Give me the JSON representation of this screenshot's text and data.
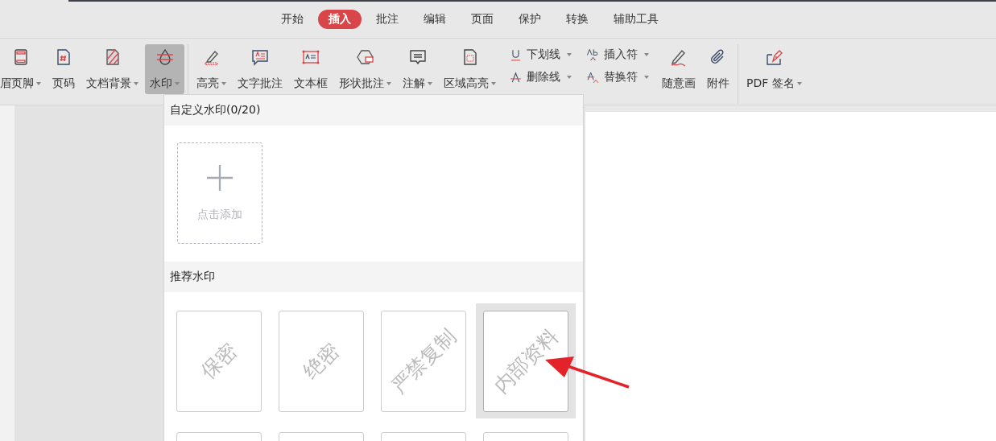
{
  "menu_tabs": [
    {
      "label": "开始",
      "selected": false
    },
    {
      "label": "插入",
      "selected": true
    },
    {
      "label": "批注",
      "selected": false
    },
    {
      "label": "编辑",
      "selected": false
    },
    {
      "label": "页面",
      "selected": false
    },
    {
      "label": "保护",
      "selected": false
    },
    {
      "label": "转换",
      "selected": false
    },
    {
      "label": "辅助工具",
      "selected": false
    }
  ],
  "toolbar": {
    "groups": [
      {
        "items": [
          {
            "kind": "big",
            "label": "眉页脚",
            "has_menu": true,
            "selected": false
          },
          {
            "kind": "big",
            "label": "页码",
            "has_menu": false,
            "selected": false
          },
          {
            "kind": "big",
            "label": "文档背景",
            "has_menu": true,
            "selected": false
          },
          {
            "kind": "big",
            "label": "水印",
            "has_menu": true,
            "selected": true
          }
        ]
      },
      {
        "items": [
          {
            "kind": "big",
            "label": "高亮",
            "has_menu": true,
            "selected": false
          },
          {
            "kind": "big",
            "label": "文字批注",
            "has_menu": false,
            "selected": false
          },
          {
            "kind": "big",
            "label": "文本框",
            "has_menu": false,
            "selected": false
          },
          {
            "kind": "big",
            "label": "形状批注",
            "has_menu": true,
            "selected": false
          },
          {
            "kind": "big",
            "label": "注解",
            "has_menu": true,
            "selected": false
          },
          {
            "kind": "big",
            "label": "区域高亮",
            "has_menu": true,
            "selected": false
          },
          {
            "kind": "stack",
            "rows": [
              {
                "label": "下划线",
                "has_menu": true
              },
              {
                "label": "删除线",
                "has_menu": true
              }
            ]
          },
          {
            "kind": "stack",
            "rows": [
              {
                "label": "插入符",
                "has_menu": true
              },
              {
                "label": "替换符",
                "has_menu": true
              }
            ]
          },
          {
            "kind": "big",
            "label": "随意画",
            "has_menu": false,
            "selected": false
          },
          {
            "kind": "big",
            "label": "附件",
            "has_menu": false,
            "selected": false
          }
        ]
      },
      {
        "items": [
          {
            "kind": "big",
            "label": "PDF 签名",
            "has_menu": true,
            "selected": false
          }
        ]
      }
    ]
  },
  "watermark_menu": {
    "custom_header": "自定义水印(0/20)",
    "add_label": "点击添加",
    "recommended_header": "推荐水印",
    "presets": [
      {
        "text": "保密",
        "selected": false
      },
      {
        "text": "绝密",
        "selected": false
      },
      {
        "text": "严禁复制",
        "selected": false
      },
      {
        "text": "内部资料",
        "selected": true
      }
    ]
  }
}
